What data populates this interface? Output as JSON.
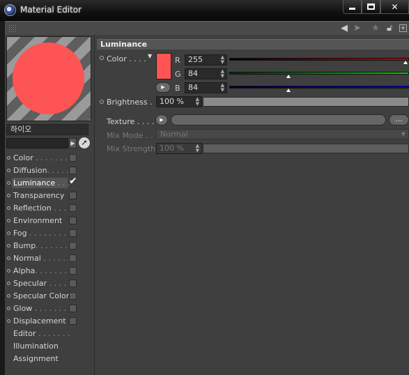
{
  "window": {
    "title": "Material Editor",
    "buttons": {
      "minimize": "minimize",
      "maximize": "maximize",
      "close": "✕"
    }
  },
  "toolbar": {
    "icons": [
      "grip-icon",
      "back-arrow-icon",
      "forward-arrow-icon",
      "star-icon",
      "lock-icon",
      "new-panel-icon"
    ]
  },
  "material": {
    "name": "하이오",
    "swatch_color": "#FF5454"
  },
  "channels": [
    {
      "label": "Color",
      "dots": " . . . . . . . .",
      "checked": false
    },
    {
      "label": "Diffusion",
      "dots": ". . . . .",
      "checked": false
    },
    {
      "label": "Luminance",
      "dots": " . . .",
      "checked": true,
      "active": true
    },
    {
      "label": "Transparency",
      "dots": "",
      "checked": false
    },
    {
      "label": "Reflection",
      "dots": " . . . .",
      "checked": false
    },
    {
      "label": "Environment",
      "dots": "",
      "checked": false
    },
    {
      "label": "Fog",
      "dots": " . . . . . . . . .",
      "checked": false
    },
    {
      "label": "Bump",
      "dots": ". . . . . . . .",
      "checked": false
    },
    {
      "label": "Normal",
      "dots": " . . . . . .",
      "checked": false
    },
    {
      "label": "Alpha",
      "dots": ". . . . . . . .",
      "checked": false
    },
    {
      "label": "Specular",
      "dots": " . . . . .",
      "checked": false
    },
    {
      "label": "Specular Color",
      "dots": "",
      "checked": false
    },
    {
      "label": "Glow",
      "dots": " . . . . . . . .",
      "checked": false
    },
    {
      "label": "Displacement",
      "dots": "",
      "checked": false
    },
    {
      "label": "Editor",
      "dots": " . . . . . . .",
      "checked": null
    },
    {
      "label": "Illumination",
      "dots": "",
      "checked": null
    },
    {
      "label": "Assignment",
      "dots": "",
      "checked": null
    }
  ],
  "luminance": {
    "header": "Luminance",
    "color_label": "Color . . . .",
    "color_hex": "#FF5454",
    "r_label": "R",
    "r_value": "255",
    "r_fraction": 1.0,
    "g_label": "G",
    "g_value": "84",
    "g_fraction": 0.33,
    "b_label": "B",
    "b_value": "84",
    "b_fraction": 0.33,
    "brightness_label": "Brightness .",
    "brightness_value": "100 %",
    "brightness_fraction": 1.0,
    "texture_label": "Texture . . . .",
    "texture_more": "...",
    "mix_mode_label": "Mix Mode . .",
    "mix_mode_value": "Normal",
    "mix_strength_label": "Mix Strength",
    "mix_strength_value": "100 %",
    "mix_strength_fraction": 1.0
  }
}
